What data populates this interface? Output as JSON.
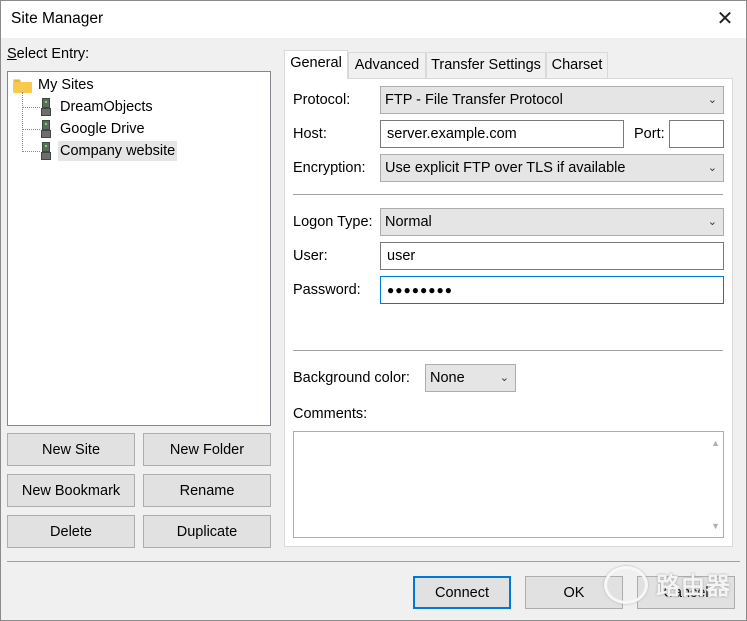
{
  "window": {
    "title": "Site Manager",
    "close_glyph": "✕"
  },
  "left": {
    "select_entry_label": "Select Entry:",
    "tree": {
      "root": {
        "label": "My Sites",
        "icon": "folder-icon"
      },
      "children": [
        {
          "label": "DreamObjects",
          "icon": "server-icon"
        },
        {
          "label": "Google Drive",
          "icon": "server-icon"
        },
        {
          "label": "Company website",
          "icon": "server-icon",
          "selected": true
        }
      ]
    },
    "buttons": {
      "new_site": "New Site",
      "new_folder": "New Folder",
      "new_bookmark": "New Bookmark",
      "rename": "Rename",
      "delete": "Delete",
      "duplicate": "Duplicate"
    }
  },
  "tabs": [
    "General",
    "Advanced",
    "Transfer Settings",
    "Charset"
  ],
  "general": {
    "protocol_label": "Protocol:",
    "protocol_value": "FTP - File Transfer Protocol",
    "host_label": "Host:",
    "host_value": "server.example.com",
    "port_label": "Port:",
    "port_value": "",
    "encryption_label": "Encryption:",
    "encryption_value": "Use explicit FTP over TLS if available",
    "logon_type_label": "Logon Type:",
    "logon_type_value": "Normal",
    "user_label": "User:",
    "user_value": "user",
    "password_label": "Password:",
    "password_value": "●●●●●●●●",
    "background_color_label": "Background color:",
    "background_color_value": "None",
    "comments_label": "Comments:",
    "comments_value": ""
  },
  "footer": {
    "connect": "Connect",
    "ok": "OK",
    "cancel": "Cancel"
  },
  "watermark": {
    "text": "路由器"
  },
  "colors": {
    "accent": "#0078d7",
    "folder": "#f8c94b",
    "selection": "#e5e5e5"
  }
}
